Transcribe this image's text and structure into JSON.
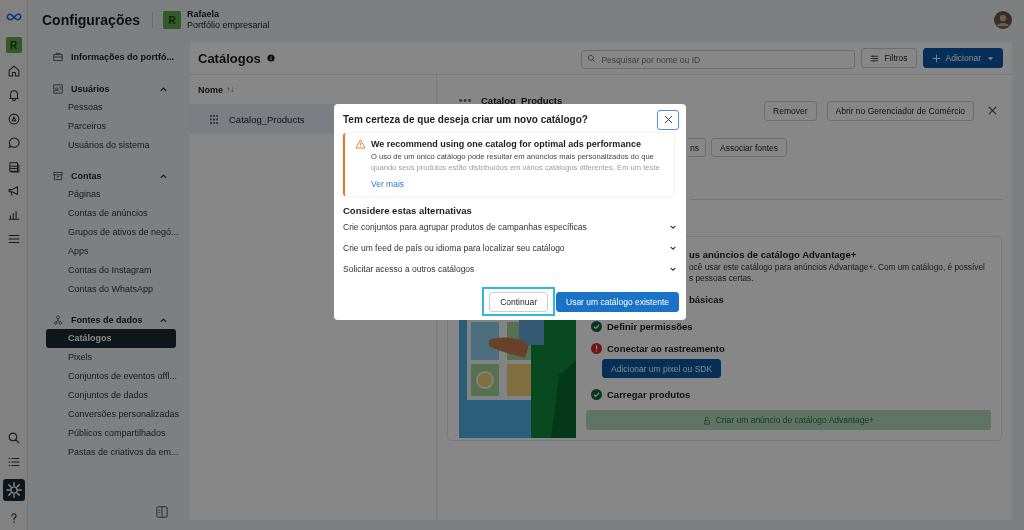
{
  "header": {
    "title": "Configurações",
    "account": {
      "initial": "R",
      "name": "Rafaela",
      "subtitle": "Portfólio empresarial"
    }
  },
  "rail": {
    "initial": "R",
    "items": [
      {
        "kind": "home",
        "selected": false
      },
      {
        "kind": "bell",
        "selected": false
      },
      {
        "kind": "compass",
        "selected": false
      },
      {
        "kind": "chat",
        "selected": false
      },
      {
        "kind": "layers",
        "selected": false
      },
      {
        "kind": "megaphone",
        "selected": false
      },
      {
        "kind": "chart",
        "selected": false
      },
      {
        "kind": "menu",
        "selected": false
      }
    ],
    "bottom_items": [
      {
        "kind": "search",
        "selected": false
      },
      {
        "kind": "list",
        "selected": false
      },
      {
        "kind": "gear",
        "selected": true
      },
      {
        "kind": "help",
        "selected": false
      }
    ]
  },
  "sidebar": {
    "top_item": {
      "label": "Informações do portfó..."
    },
    "sections": [
      {
        "title": "Usuários",
        "expanded": true,
        "items": [
          {
            "label": "Pessoas",
            "selected": false
          },
          {
            "label": "Parceiros",
            "selected": false
          },
          {
            "label": "Usuários do sistema",
            "selected": false
          }
        ]
      },
      {
        "title": "Contas",
        "expanded": true,
        "items": [
          {
            "label": "Páginas",
            "selected": false
          },
          {
            "label": "Contas de anúncios",
            "selected": false
          },
          {
            "label": "Grupos de ativos de negó...",
            "selected": false
          },
          {
            "label": "Apps",
            "selected": false
          },
          {
            "label": "Contas do Instagram",
            "selected": false
          },
          {
            "label": "Contas do WhatsApp",
            "selected": false
          }
        ]
      },
      {
        "title": "Fontes de dados",
        "expanded": true,
        "items": [
          {
            "label": "Catálogos",
            "selected": true
          },
          {
            "label": "Pixels",
            "selected": false
          },
          {
            "label": "Conjuntos de eventos offl...",
            "selected": false
          },
          {
            "label": "Conjuntos de dados",
            "selected": false
          },
          {
            "label": "Conversões personalizadas",
            "selected": false
          },
          {
            "label": "Públicos compartilhados",
            "selected": false
          },
          {
            "label": "Pastas de criativos da em...",
            "selected": false
          }
        ]
      }
    ]
  },
  "main": {
    "title": "Catálogos",
    "search": {
      "placeholder": "Pesquisar por nome ou ID"
    },
    "filter_button": "Filtros",
    "add_button": "Adicionar",
    "list": {
      "column": "Nome",
      "sort_mark": "↑↓",
      "rows": [
        {
          "name": "Catalog_Products",
          "selected": true
        }
      ]
    }
  },
  "detail": {
    "title": "Catalog_Products",
    "buttons": [
      "Remover",
      "Abrir no Gerenciador de Comércio"
    ],
    "secondary_buttons": [
      "ns",
      "Associar fontes"
    ],
    "card": {
      "heading": "us anúncios de catálogo Advantage+",
      "lines": [
        "ocê usar este catálogo para anúncios Advantage+. Com um catálogo, é possível",
        "s pessoas certas."
      ],
      "section": "básicas",
      "steps": [
        {
          "label": "Definir permissões",
          "kind": "done"
        },
        {
          "label": "Conectar ao rastreamento",
          "kind": "error",
          "action": "Adicionar um pixel ou SDK"
        },
        {
          "label": "Carregar produtos",
          "kind": "done"
        }
      ],
      "create_button": {
        "label": "Criar um anúncio de catálogo Advantage+",
        "disabled": true
      }
    }
  },
  "dialog": {
    "title": "Tem certeza de que deseja criar um novo catálogo?",
    "warning": {
      "title": "We recommend using one catalog for optimal ads performance",
      "lines": [
        "O uso de um único catálogo pode resultar em anúncios mais personalizados do que",
        "quando seus produtos estão distribuídos em vários catálogos diferentes. Em um teste"
      ],
      "link": "Ver mais"
    },
    "alternatives_title": "Considere estas alternativas",
    "alternatives": [
      {
        "label": "Crie conjuntos para agrupar produtos de campanhas específicas",
        "expanded": false
      },
      {
        "label": "Crie um feed de país ou idioma para localizar seu catálogo",
        "expanded": false
      },
      {
        "label": "Solicitar acesso a outros catálogos",
        "expanded": false
      }
    ],
    "buttons": [
      {
        "label": "Continuar",
        "kind": "secondary",
        "highlighted": true
      },
      {
        "label": "Usar um catálogo existente",
        "kind": "primary",
        "highlighted": false
      }
    ]
  }
}
